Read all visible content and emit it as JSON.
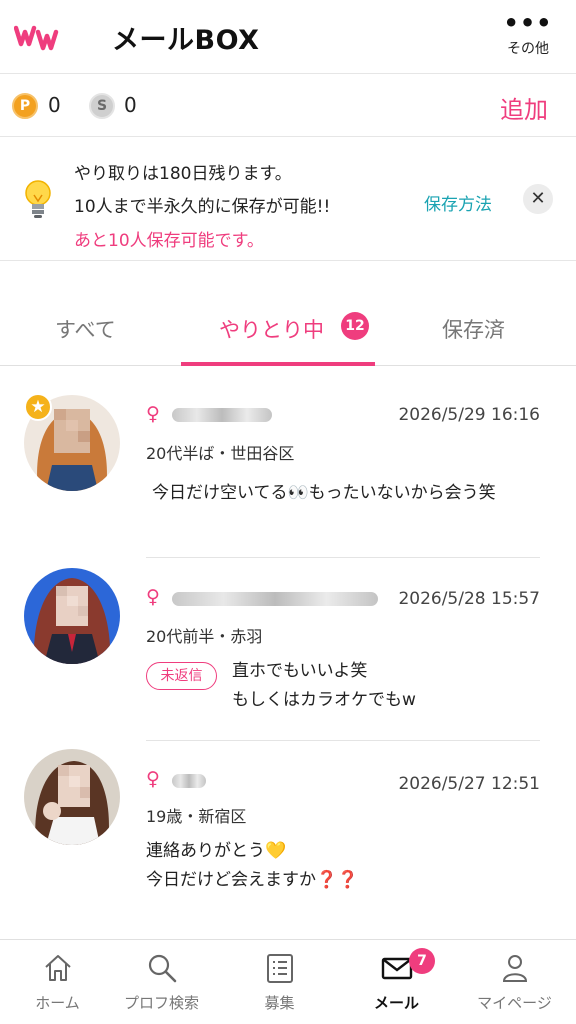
{
  "header": {
    "title": "メールBOX",
    "more_label": "その他",
    "more_dots": "•••",
    "logo_icon": "ww-logo-icon"
  },
  "points": {
    "p_label": "P",
    "p_value": "0",
    "s_label": "S",
    "s_value": "0",
    "add_label": "追加"
  },
  "notice": {
    "line1": "やり取りは180日残ります。",
    "line2": "10人まで半永久的に保存が可能!!",
    "line3": "あと10人保存可能です。",
    "link": "保存方法",
    "close": "✕",
    "icon": "lightbulb-icon"
  },
  "tabs": [
    {
      "label": "すべて"
    },
    {
      "label": "やりとり中",
      "badge": "12"
    },
    {
      "label": "保存済"
    }
  ],
  "messages": [
    {
      "gender": "♀",
      "date": "2026/5/29 16:16",
      "meta": "20代半ば・世田谷区",
      "text": "今日だけ空いてる👀もったいないから会う笑",
      "favorite": "★"
    },
    {
      "gender": "♀",
      "date": "2026/5/28 15:57",
      "meta": "20代前半・赤羽",
      "badge": "未返信",
      "text_lines": [
        "直ホでもいいよ笑",
        "もしくはカラオケでもw"
      ]
    },
    {
      "gender": "♀",
      "date": "2026/5/27 12:51",
      "meta": "19歳・新宿区",
      "text_lines": [
        "連絡ありがとう💛",
        "今日だけど会えますか❓❓"
      ]
    }
  ],
  "nav": [
    {
      "label": "ホーム",
      "icon": "home-icon"
    },
    {
      "label": "プロフ検索",
      "icon": "search-icon"
    },
    {
      "label": "募集",
      "icon": "list-icon"
    },
    {
      "label": "メール",
      "icon": "mail-icon",
      "badge": "7"
    },
    {
      "label": "マイページ",
      "icon": "person-icon"
    }
  ],
  "colors": {
    "accent": "#ef3d7e",
    "link": "#1aa3b2",
    "coin_gold": "#f3a120",
    "coin_silver": "#cfcfcf"
  }
}
